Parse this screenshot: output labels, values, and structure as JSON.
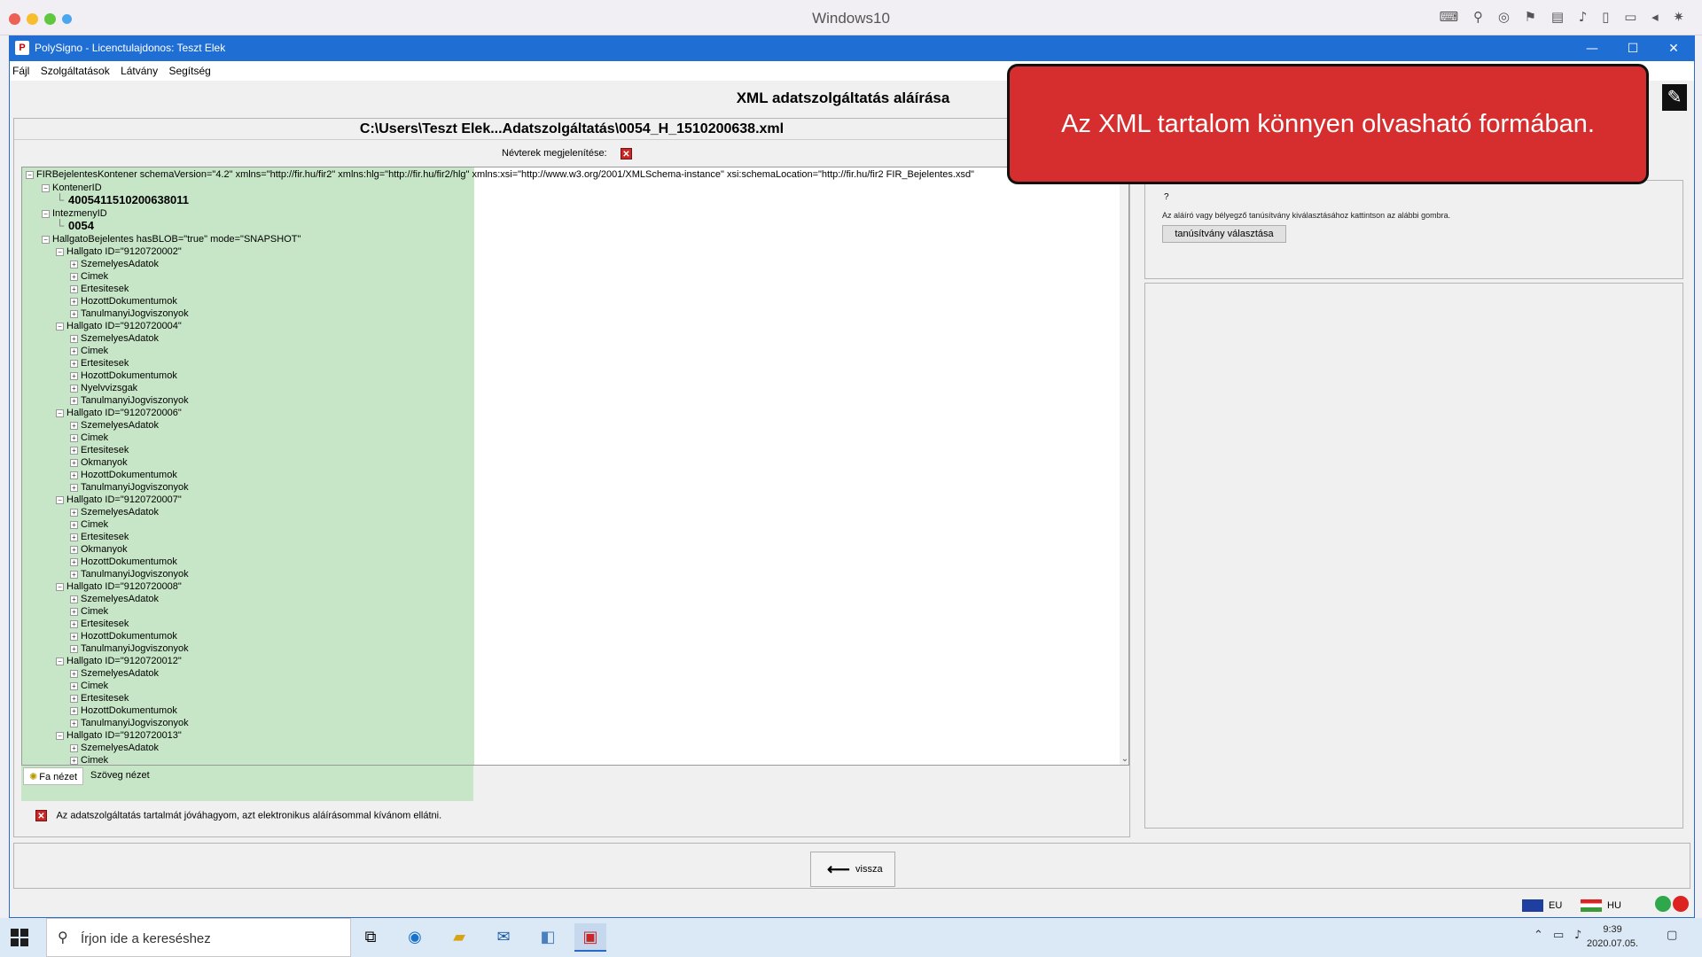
{
  "host": {
    "title": "Windows10",
    "tray_icons": "⌨ ⚲ ◎ ⚑ ▤ ♪ ▯ ▭ ◂ ✷"
  },
  "window": {
    "title": "PolySigno - Licenctulajdonos: Teszt Elek",
    "menu": [
      "Fájl",
      "Szolgáltatások",
      "Látvány",
      "Segítség"
    ],
    "controls": {
      "minimize": "—",
      "maximize": "☐",
      "close": "✕"
    }
  },
  "page": {
    "heading": "XML adatszolgáltatás aláírása",
    "file_path": "C:\\Users\\Teszt Elek...Adatszolgáltatás\\0054_H_1510200638.xml",
    "namespaces_label": "Névterek megjelenítése:",
    "checkbox_mark": "✕",
    "tab_tree": "Fa nézet",
    "tab_text": "Szöveg nézet",
    "approve_text": "Az adatszolgáltatás tartalmát jóváhagyom, azt elektronikus aláírásommal kívánom ellátni.",
    "back_label": "vissza"
  },
  "tree": {
    "root": "FIRBejelentesKontener schemaVersion=\"4.2\" xmlns=\"http://fir.hu/fir2\" xmlns:hlg=\"http://fir.hu/fir2/hlg\" xmlns:xsi=\"http://www.w3.org/2001/XMLSchema-instance\" xsi:schemaLocation=\"http://fir.hu/fir2 FIR_Bejelentes.xsd\"",
    "nodes": [
      {
        "text": "KontenerID",
        "level": 1,
        "pm": "−"
      },
      {
        "text": "4005411510200638011",
        "level": 2,
        "pm": "",
        "big": true
      },
      {
        "text": "IntezmenyID",
        "level": 1,
        "pm": "−"
      },
      {
        "text": "0054",
        "level": 2,
        "pm": "",
        "big": true
      },
      {
        "text": "HallgatoBejelentes hasBLOB=\"true\" mode=\"SNAPSHOT\"",
        "level": 1,
        "pm": "−"
      },
      {
        "text": "Hallgato ID=\"9120720002\"",
        "level": 2,
        "pm": "−"
      },
      {
        "text": "SzemelyesAdatok",
        "level": 3,
        "pm": "+"
      },
      {
        "text": "Cimek",
        "level": 3,
        "pm": "+"
      },
      {
        "text": "Ertesitesek",
        "level": 3,
        "pm": "+"
      },
      {
        "text": "HozottDokumentumok",
        "level": 3,
        "pm": "+"
      },
      {
        "text": "TanulmanyiJogviszonyok",
        "level": 3,
        "pm": "+"
      },
      {
        "text": "Hallgato ID=\"9120720004\"",
        "level": 2,
        "pm": "−"
      },
      {
        "text": "SzemelyesAdatok",
        "level": 3,
        "pm": "+"
      },
      {
        "text": "Cimek",
        "level": 3,
        "pm": "+"
      },
      {
        "text": "Ertesitesek",
        "level": 3,
        "pm": "+"
      },
      {
        "text": "HozottDokumentumok",
        "level": 3,
        "pm": "+"
      },
      {
        "text": "Nyelvvizsgak",
        "level": 3,
        "pm": "+"
      },
      {
        "text": "TanulmanyiJogviszonyok",
        "level": 3,
        "pm": "+"
      },
      {
        "text": "Hallgato ID=\"9120720006\"",
        "level": 2,
        "pm": "−"
      },
      {
        "text": "SzemelyesAdatok",
        "level": 3,
        "pm": "+"
      },
      {
        "text": "Cimek",
        "level": 3,
        "pm": "+"
      },
      {
        "text": "Ertesitesek",
        "level": 3,
        "pm": "+"
      },
      {
        "text": "Okmanyok",
        "level": 3,
        "pm": "+"
      },
      {
        "text": "HozottDokumentumok",
        "level": 3,
        "pm": "+"
      },
      {
        "text": "TanulmanyiJogviszonyok",
        "level": 3,
        "pm": "+"
      },
      {
        "text": "Hallgato ID=\"9120720007\"",
        "level": 2,
        "pm": "−"
      },
      {
        "text": "SzemelyesAdatok",
        "level": 3,
        "pm": "+"
      },
      {
        "text": "Cimek",
        "level": 3,
        "pm": "+"
      },
      {
        "text": "Ertesitesek",
        "level": 3,
        "pm": "+"
      },
      {
        "text": "Okmanyok",
        "level": 3,
        "pm": "+"
      },
      {
        "text": "HozottDokumentumok",
        "level": 3,
        "pm": "+"
      },
      {
        "text": "TanulmanyiJogviszonyok",
        "level": 3,
        "pm": "+"
      },
      {
        "text": "Hallgato ID=\"9120720008\"",
        "level": 2,
        "pm": "−"
      },
      {
        "text": "SzemelyesAdatok",
        "level": 3,
        "pm": "+"
      },
      {
        "text": "Cimek",
        "level": 3,
        "pm": "+"
      },
      {
        "text": "Ertesitesek",
        "level": 3,
        "pm": "+"
      },
      {
        "text": "HozottDokumentumok",
        "level": 3,
        "pm": "+"
      },
      {
        "text": "TanulmanyiJogviszonyok",
        "level": 3,
        "pm": "+"
      },
      {
        "text": "Hallgato ID=\"9120720012\"",
        "level": 2,
        "pm": "−"
      },
      {
        "text": "SzemelyesAdatok",
        "level": 3,
        "pm": "+"
      },
      {
        "text": "Cimek",
        "level": 3,
        "pm": "+"
      },
      {
        "text": "Ertesitesek",
        "level": 3,
        "pm": "+"
      },
      {
        "text": "HozottDokumentumok",
        "level": 3,
        "pm": "+"
      },
      {
        "text": "TanulmanyiJogviszonyok",
        "level": 3,
        "pm": "+"
      },
      {
        "text": "Hallgato ID=\"9120720013\"",
        "level": 2,
        "pm": "−"
      },
      {
        "text": "SzemelyesAdatok",
        "level": 3,
        "pm": "+"
      },
      {
        "text": "Cimek",
        "level": 3,
        "pm": "+"
      }
    ]
  },
  "right": {
    "question_mark": "?",
    "hint": "Az aláíró vagy bélyegző tanúsítvány kiválasztásához kattintson az alábbi gombra.",
    "cert_button": "tanúsítvány választása"
  },
  "status": {
    "lang_eu": "EU",
    "lang_hu": "HU"
  },
  "callout": {
    "text": "Az XML tartalom könnyen olvasható formában."
  },
  "taskbar": {
    "search_placeholder": "Írjon ide a kereséshez",
    "time": "9:39",
    "date": "2020.07.05."
  },
  "colors": {
    "accent": "#1f6ed4",
    "tree_highlight": "#c7e6c7",
    "callout": "#d62e2e"
  }
}
